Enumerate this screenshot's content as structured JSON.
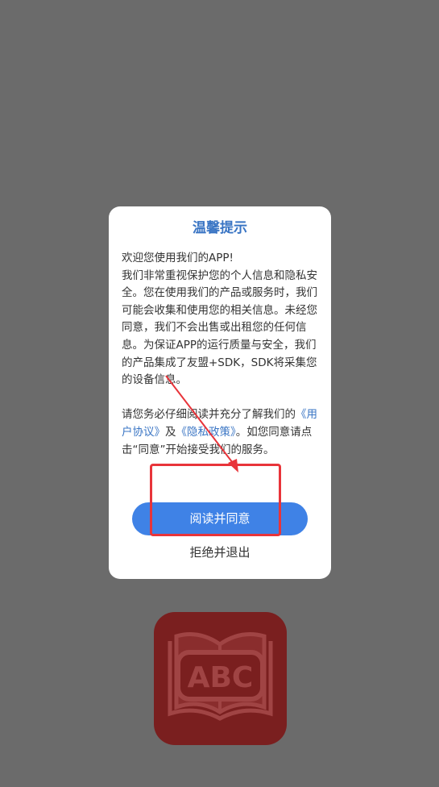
{
  "dialog": {
    "title": "温馨提示",
    "para1": "欢迎您使用我们的APP!\n我们非常重视保护您的个人信息和隐私安全。您在使用我们的产品或服务时，我们可能会收集和使用您的相关信息。未经您同意，我们不会出售或出租您的任何信息。为保证APP的运行质量与安全，我们的产品集成了友盟+SDK，SDK将采集您的设备信息。",
    "para2_before": "请您务必仔细阅读并充分了解我们的",
    "link_user": "《用户协议》",
    "and": "及",
    "link_privacy": "《隐私政策》",
    "para2_after": "。如您同意请点击“同意”开始接受我们的服务。",
    "agree_label": "阅读并同意",
    "reject_label": "拒绝并退出"
  },
  "app_icon": {
    "text": "ABC",
    "name": "book-abc-icon"
  },
  "colors": {
    "accent": "#3f82e6",
    "link": "#3a75c4",
    "annotation": "#e8343a",
    "overlay": "#6b6b6b"
  }
}
